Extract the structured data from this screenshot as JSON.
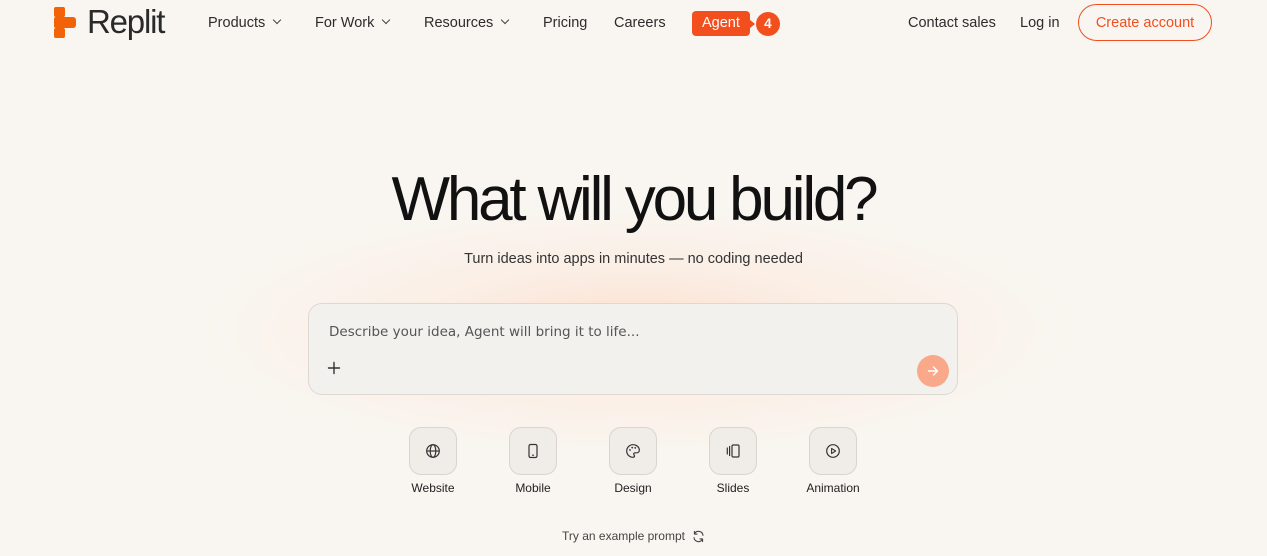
{
  "brand": {
    "name": "Replit",
    "accent": "#f24e1e"
  },
  "nav": {
    "products": "Products",
    "for_work": "For Work",
    "resources": "Resources",
    "pricing": "Pricing",
    "careers": "Careers",
    "agent": "Agent",
    "agent_count": "4",
    "contact_sales": "Contact sales",
    "log_in": "Log in",
    "create_account": "Create account"
  },
  "hero": {
    "title": "What will you build?",
    "subtitle": "Turn ideas into apps in minutes — no coding needed"
  },
  "prompt": {
    "placeholder": "Describe your idea, Agent will bring it to life...",
    "value": ""
  },
  "categories": [
    {
      "label": "Website",
      "icon": "globe-icon"
    },
    {
      "label": "Mobile",
      "icon": "phone-icon"
    },
    {
      "label": "Design",
      "icon": "palette-icon"
    },
    {
      "label": "Slides",
      "icon": "slides-icon"
    },
    {
      "label": "Animation",
      "icon": "play-circle-icon"
    }
  ],
  "example": {
    "label": "Try an example prompt",
    "icon": "refresh-icon"
  }
}
